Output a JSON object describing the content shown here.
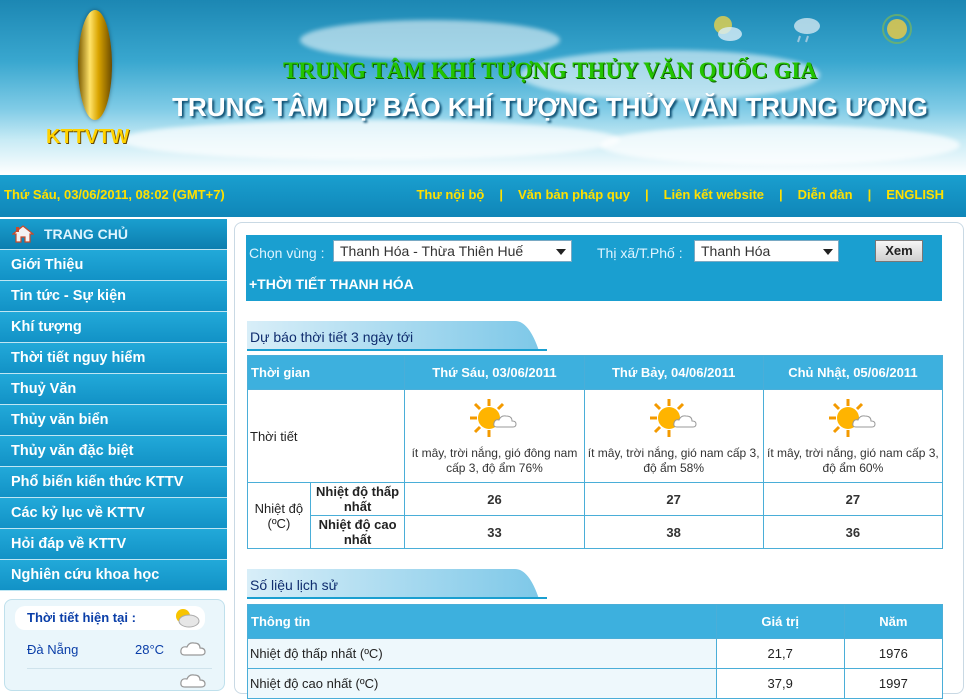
{
  "header": {
    "logo_text": "KTTVTW",
    "org_line1": "TRUNG TÂM KHÍ TƯỢNG THỦY VĂN QUỐC GIA",
    "org_line2": "TRUNG TÂM DỰ BÁO KHÍ TƯỢNG THỦY VĂN TRUNG ƯƠNG"
  },
  "topbar": {
    "date": "Thứ Sáu, 03/06/2011, 08:02 (GMT+7)",
    "links": [
      "Thư nội bộ",
      "Văn bản pháp quy",
      "Liên kết website",
      "Diễn đàn",
      "ENGLISH"
    ]
  },
  "sidebar": {
    "home_label": "TRANG CHỦ",
    "items": [
      "Giới Thiệu",
      "Tin tức - Sự kiện",
      "Khí tượng",
      "Thời tiết nguy hiểm",
      "Thuỷ Văn",
      "Thủy văn biển",
      "Thủy văn đặc biệt",
      "Phổ biến kiến thức KTTV",
      "Các kỷ lục về KTTV",
      "Hỏi đáp về KTTV",
      "Nghiên cứu khoa học"
    ],
    "current_weather": {
      "title": "Thời tiết hiện tại :",
      "rows": [
        {
          "city": "Đà Nẵng",
          "temp": "28°C",
          "icon": "cloud-icon"
        }
      ]
    }
  },
  "filter": {
    "region_label": "Chọn vùng :",
    "region_value": "Thanh Hóa - Thừa Thiên Huế",
    "city_label": "Thị xã/T.Phố :",
    "city_value": "Thanh Hóa",
    "submit_label": "Xem",
    "location_title": "+THỜI TIẾT  THANH HÓA"
  },
  "forecast": {
    "section_title": "Dự báo thời tiết 3 ngày tới",
    "col_time": "Thời gian",
    "days": [
      "Thứ Sáu, 03/06/2011",
      "Thứ Bảy, 04/06/2011",
      "Chủ Nhật, 05/06/2011"
    ],
    "row_weather": "Thời tiết",
    "descriptions": [
      "ít mây, trời nắng, gió đông nam cấp 3, độ ẩm 76%",
      "ít mây, trời nắng, gió nam cấp 3, độ ẩm 58%",
      "ít mây, trời nắng, gió nam cấp 3, độ ẩm 60%"
    ],
    "row_temp": "Nhiệt độ (ºC)",
    "row_min": "Nhiệt độ thấp nhất",
    "row_max": "Nhiệt độ cao nhất",
    "min_values": [
      "26",
      "27",
      "27"
    ],
    "max_values": [
      "33",
      "38",
      "36"
    ]
  },
  "history": {
    "section_title": "Số liệu lịch sử",
    "col_info": "Thông tin",
    "col_value": "Giá trị",
    "col_year": "Năm",
    "rows": [
      {
        "info": "Nhiệt độ thấp nhất (ºC)",
        "value": "21,7",
        "year": "1976"
      },
      {
        "info": "Nhiệt độ cao nhất (ºC)",
        "value": "37,9",
        "year": "1997"
      }
    ]
  },
  "colors": {
    "banner_blue": "#1c87b3",
    "menu_blue": "#1a9fcf",
    "link_yellow": "#ffe000",
    "org_green": "#23c400"
  }
}
